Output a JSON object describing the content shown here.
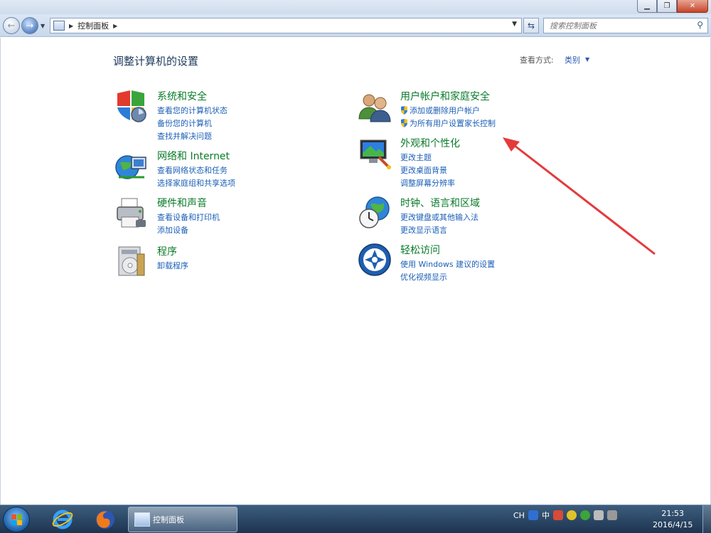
{
  "window": {
    "minimize_glyph": "▁",
    "maximize_glyph": "❐",
    "close_glyph": "✕"
  },
  "navbar": {
    "back_glyph": "←",
    "forward_glyph": "→",
    "breadcrumb": "控制面板",
    "search_placeholder": "搜索控制面板"
  },
  "content": {
    "title": "调整计算机的设置",
    "view_by_label": "查看方式:",
    "view_by_value": "类别"
  },
  "categories": [
    {
      "title": "系统和安全",
      "icon": "security-shield-icon",
      "links": [
        "查看您的计算机状态",
        "备份您的计算机",
        "查找并解决问题"
      ]
    },
    {
      "title": "网络和 Internet",
      "icon": "network-globe-icon",
      "links": [
        "查看网络状态和任务",
        "选择家庭组和共享选项"
      ]
    },
    {
      "title": "硬件和声音",
      "icon": "printer-icon",
      "links": [
        "查看设备和打印机",
        "添加设备"
      ]
    },
    {
      "title": "程序",
      "icon": "programs-disc-icon",
      "links": [
        "卸载程序"
      ]
    },
    {
      "title": "用户帐户和家庭安全",
      "icon": "users-icon",
      "links": [
        "添加或删除用户帐户",
        "为所有用户设置家长控制"
      ]
    },
    {
      "title": "外观和个性化",
      "icon": "monitor-icon",
      "links": [
        "更改主题",
        "更改桌面背景",
        "调整屏幕分辨率"
      ]
    },
    {
      "title": "时钟、语言和区域",
      "icon": "clock-globe-icon",
      "links": [
        "更改键盘或其他输入法",
        "更改显示语言"
      ]
    },
    {
      "title": "轻松访问",
      "icon": "ease-of-access-icon",
      "links": [
        "使用 Windows 建议的设置",
        "优化视频显示"
      ]
    }
  ],
  "taskbar": {
    "window_label": "控制面板",
    "tray_lang": "CH",
    "tray_ime": "中",
    "time": "21:53",
    "date": "2016/4/15"
  },
  "colors": {
    "category_title": "#0a7a2a",
    "link": "#1b5fb7",
    "annotation_arrow": "#e53a3a"
  }
}
